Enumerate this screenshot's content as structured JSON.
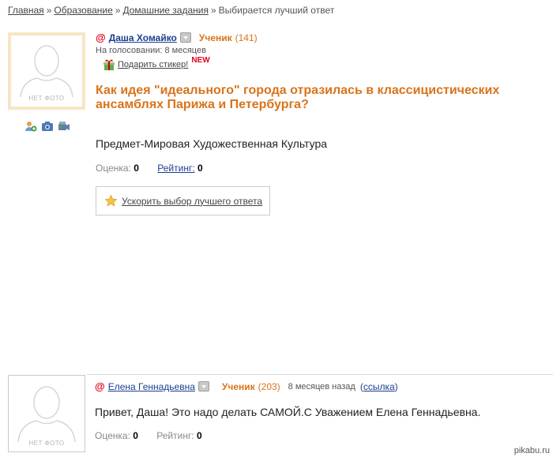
{
  "breadcrumb": {
    "home": "Главная",
    "education": "Образование",
    "homework": "Домашние задания",
    "current": "Выбирается лучший ответ",
    "separator": "»"
  },
  "question": {
    "author": "Даша Хомайко",
    "rank": "Ученик",
    "rank_count": "(141)",
    "voting": "На голосовании: 8 месяцев",
    "gift_label": "Подарить стикер!",
    "gift_badge": "NEW",
    "title": "Как идея \"идеального\" города отразилась в классицистических ансамблях Парижа и Петербурга?",
    "category": "Предмет-Мировая Художественная Культура",
    "score_label": "Оценка:",
    "score_value": "0",
    "rating_label": "Рейтинг:",
    "rating_value": "0",
    "speed_up": "Ускорить выбор лучшего ответа",
    "no_photo": "НЕТ ФОТО"
  },
  "answer": {
    "author": "Елена Геннадьевна",
    "rank": "Ученик",
    "rank_count": "(203)",
    "time": "8 месяцев назад",
    "link_open": "(",
    "link_label": "ссылка",
    "link_close": ")",
    "text": "Привет, Даша! Это надо делать САМОЙ.С Уважением Елена Геннадьевна.",
    "score_label": "Оценка:",
    "score_value": "0",
    "rating_label": "Рейтинг:",
    "rating_value": "0",
    "no_photo": "НЕТ ФОТО"
  },
  "watermark": "pikabu.ru",
  "colors": {
    "accent": "#d9731a",
    "link": "#1a3f8f",
    "at": "#e2001a"
  }
}
